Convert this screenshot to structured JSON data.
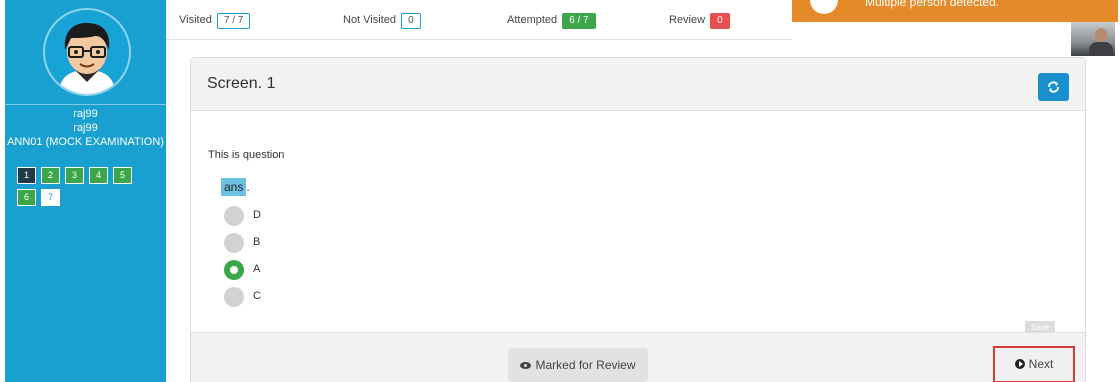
{
  "sidebar": {
    "username": "raj99",
    "user_id": "raj99",
    "exam": "ANN01 (MOCK EXAMINATION)",
    "questions": [
      {
        "label": "1",
        "state": "current"
      },
      {
        "label": "2",
        "state": "answered"
      },
      {
        "label": "3",
        "state": "answered"
      },
      {
        "label": "4",
        "state": "answered"
      },
      {
        "label": "5",
        "state": "answered"
      },
      {
        "label": "6",
        "state": "answered"
      },
      {
        "label": "7",
        "state": "unvisited"
      }
    ]
  },
  "stats": {
    "visited_label": "Visited",
    "visited_value": "7 / 7",
    "not_visited_label": "Not Visited",
    "not_visited_value": "0",
    "attempted_label": "Attempted",
    "attempted_value": "6 / 7",
    "review_label": "Review",
    "review_value": "0"
  },
  "toast": {
    "message": "Multiple person detected."
  },
  "question": {
    "title": "Screen. 1",
    "text": "This is question",
    "answer_prefix": "ans",
    "answer_suffix": ".",
    "options": [
      {
        "label": "D",
        "selected": false
      },
      {
        "label": "B",
        "selected": false
      },
      {
        "label": "A",
        "selected": true
      },
      {
        "label": "C",
        "selected": false
      }
    ],
    "save_chip": "Save"
  },
  "footer": {
    "review_button": "Marked for Review",
    "next_button": "Next"
  },
  "colors": {
    "sidebar": "#1aa0d0",
    "answered": "#3ca64a",
    "current": "#213a4a",
    "review_badge": "#e84c4c",
    "toast": "#e48a28",
    "next_border": "#d43a3a"
  }
}
